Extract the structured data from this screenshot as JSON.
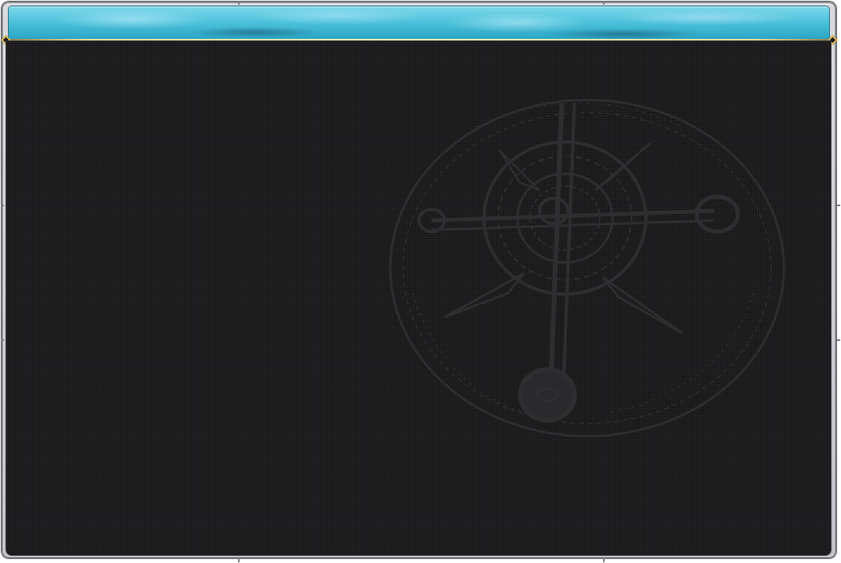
{
  "window": {
    "title": "",
    "header_color": "#4fc3dc",
    "trim_color": "#e9d79a",
    "panel_color": "#1d1c1e",
    "frame_color": "#c8c9cd"
  },
  "decoration": {
    "background_emblem": "arcane-compass-sigil-icon",
    "corner_ornaments": "diamond-gem-icon"
  }
}
